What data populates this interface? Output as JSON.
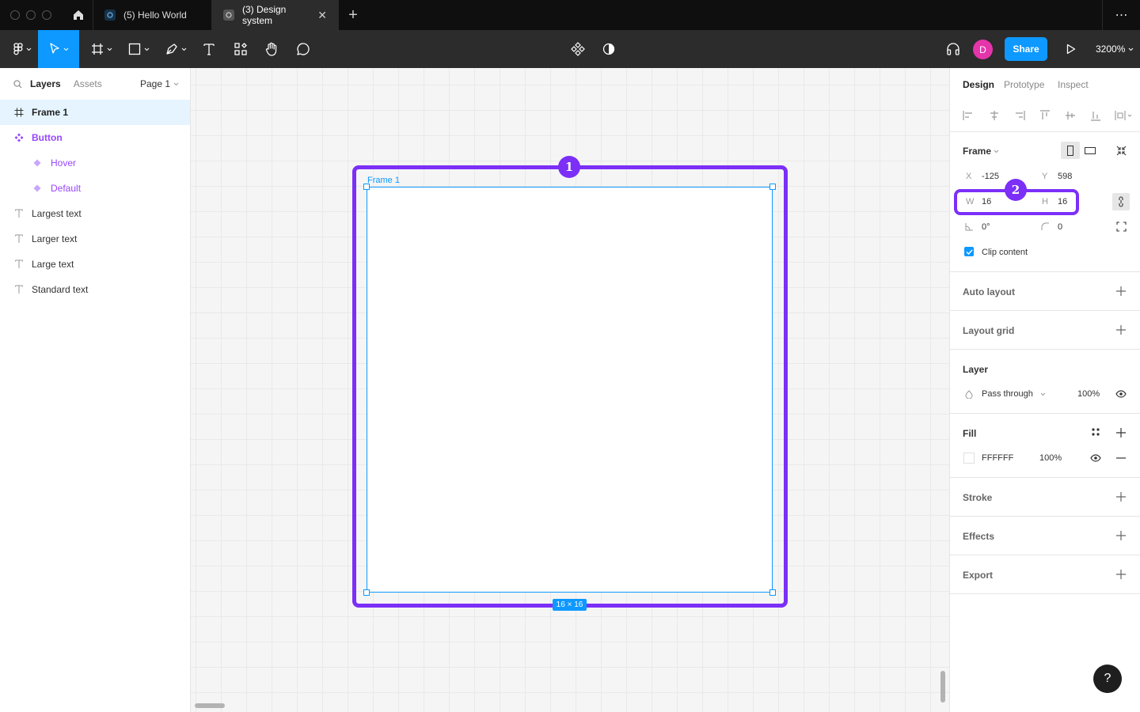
{
  "titlebar": {
    "tabs": [
      {
        "label": "(5) Hello World",
        "active": false
      },
      {
        "label": "(3) Design system",
        "active": true
      }
    ],
    "close_glyph": "✕",
    "new_tab_glyph": "+",
    "more_glyph": "⋯"
  },
  "toolbar": {
    "share_label": "Share",
    "avatar_initial": "D",
    "zoom_level": "3200%",
    "colors": {
      "accent": "#0d99ff",
      "avatar": "#e535ab",
      "bar": "#2c2c2c"
    }
  },
  "left_panel": {
    "tabs": [
      "Layers",
      "Assets"
    ],
    "page_select": "Page 1",
    "layers": [
      {
        "name": "Frame 1",
        "type": "frame-icon",
        "selected": true
      },
      {
        "name": "Button",
        "type": "component-icon",
        "component": true
      },
      {
        "name": "Hover",
        "type": "variant-icon",
        "component": true,
        "child": true
      },
      {
        "name": "Default",
        "type": "variant-icon",
        "component": true,
        "child": true
      },
      {
        "name": "Largest text",
        "type": "text-icon"
      },
      {
        "name": "Larger text",
        "type": "text-icon"
      },
      {
        "name": "Large text",
        "type": "text-icon"
      },
      {
        "name": "Standard text",
        "type": "text-icon"
      }
    ]
  },
  "canvas": {
    "frame_label": "Frame 1",
    "size_badge": "16 × 16",
    "annotations": [
      {
        "number": "1",
        "color": "#7b2ff7"
      },
      {
        "number": "2",
        "color": "#7b2ff7"
      }
    ]
  },
  "right_panel": {
    "tabs": [
      "Design",
      "Prototype",
      "Inspect"
    ],
    "frame": {
      "title": "Frame",
      "x_label": "X",
      "x_value": "-125",
      "y_label": "Y",
      "y_value": "598",
      "w_label": "W",
      "w_value": "16",
      "h_label": "H",
      "h_value": "16",
      "rotation": "0°",
      "radius": "0",
      "clip_content": "Clip content"
    },
    "sections": {
      "auto_layout": "Auto layout",
      "layout_grid": "Layout grid",
      "layer": "Layer",
      "fill": "Fill",
      "stroke": "Stroke",
      "effects": "Effects",
      "export": "Export"
    },
    "layer": {
      "blend_mode": "Pass through",
      "opacity": "100%"
    },
    "fill": {
      "hex": "FFFFFF",
      "opacity": "100%"
    },
    "help_glyph": "?"
  }
}
